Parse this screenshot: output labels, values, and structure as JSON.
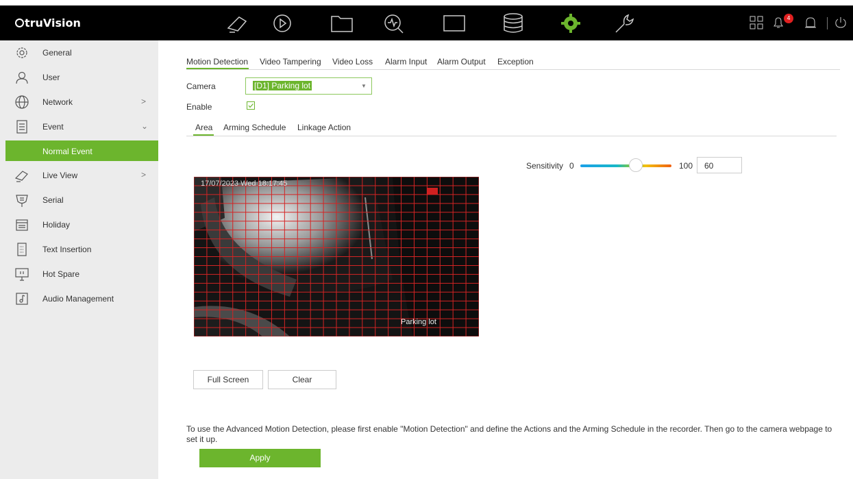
{
  "app": {
    "logo": "truVision",
    "alert_count": "4"
  },
  "topbar": {
    "icons": [
      "live-view-icon",
      "playback-icon",
      "folder-icon",
      "search-icon",
      "monitor-icon",
      "storage-icon",
      "settings-icon",
      "maintenance-icon"
    ],
    "active": "settings-icon",
    "accent": "#6cb52d"
  },
  "sidebar": {
    "items": [
      {
        "label": "General",
        "icon": "gear-icon"
      },
      {
        "label": "User",
        "icon": "user-icon"
      },
      {
        "label": "Network",
        "icon": "globe-icon",
        "arrow": ">"
      },
      {
        "label": "Event",
        "icon": "event-icon",
        "arrow": "⌄"
      },
      {
        "label": "Live View",
        "icon": "live-view-icon",
        "arrow": ">"
      },
      {
        "label": "Serial",
        "icon": "serial-icon"
      },
      {
        "label": "Holiday",
        "icon": "calendar-icon"
      },
      {
        "label": "Text Insertion",
        "icon": "text-insertion-icon"
      },
      {
        "label": "Hot Spare",
        "icon": "hot-spare-icon"
      },
      {
        "label": "Audio Management",
        "icon": "audio-icon"
      }
    ],
    "sub_item": "Normal Event"
  },
  "main": {
    "tabs": [
      "Motion Detection",
      "Video Tampering",
      "Video Loss",
      "Alarm Input",
      "Alarm Output",
      "Exception"
    ],
    "active_tab": "Motion Detection",
    "camera_label": "Camera",
    "camera_value": "[D1] Parking lot",
    "enable_label": "Enable",
    "enable_checked": true,
    "sub_tabs": [
      "Area",
      "Arming Schedule",
      "Linkage Action"
    ],
    "active_sub_tab": "Area",
    "sensitivity": {
      "label": "Sensitivity",
      "min": "0",
      "max": "100",
      "value": "60"
    },
    "video": {
      "timestamp": "17/07/2023 Wed 18:17:45",
      "camera_name": "Parking lot"
    },
    "full_screen_label": "Full Screen",
    "clear_label": "Clear",
    "note": "To use the Advanced Motion Detection, please first enable \"Motion Detection\" and define the Actions and the Arming Schedule in the recorder. Then go to the camera webpage to set it up.",
    "apply_label": "Apply"
  }
}
